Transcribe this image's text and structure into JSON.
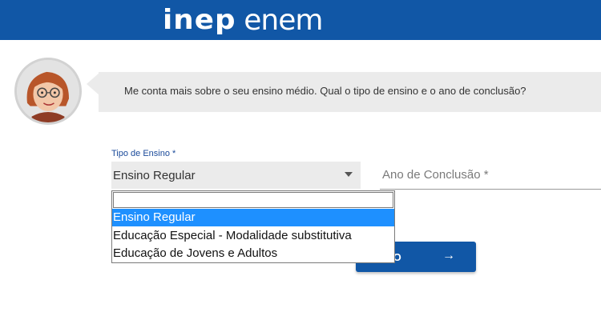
{
  "header": {
    "logo_primary": "inep",
    "logo_secondary": "enem",
    "brand_color": "#1157a6"
  },
  "assistant": {
    "avatar_icon": "cartoon-woman-avatar-icon",
    "message": "Me conta mais sobre o seu ensino médio. Qual o tipo de ensino e o ano de conclusão?"
  },
  "form": {
    "tipo_label": "Tipo de Ensino *",
    "tipo_value": "Ensino Regular",
    "ano_placeholder": "Ano de Conclusão *",
    "next_label": "XIMO",
    "next_icon": "arrow-right-icon"
  },
  "dropdown": {
    "search_value": "",
    "options": [
      "Ensino Regular",
      "Educação Especial - Modalidade substitutiva",
      "Educação de Jovens e Adultos"
    ],
    "selected": "Ensino Regular",
    "highlight_color": "#1e90ff"
  }
}
